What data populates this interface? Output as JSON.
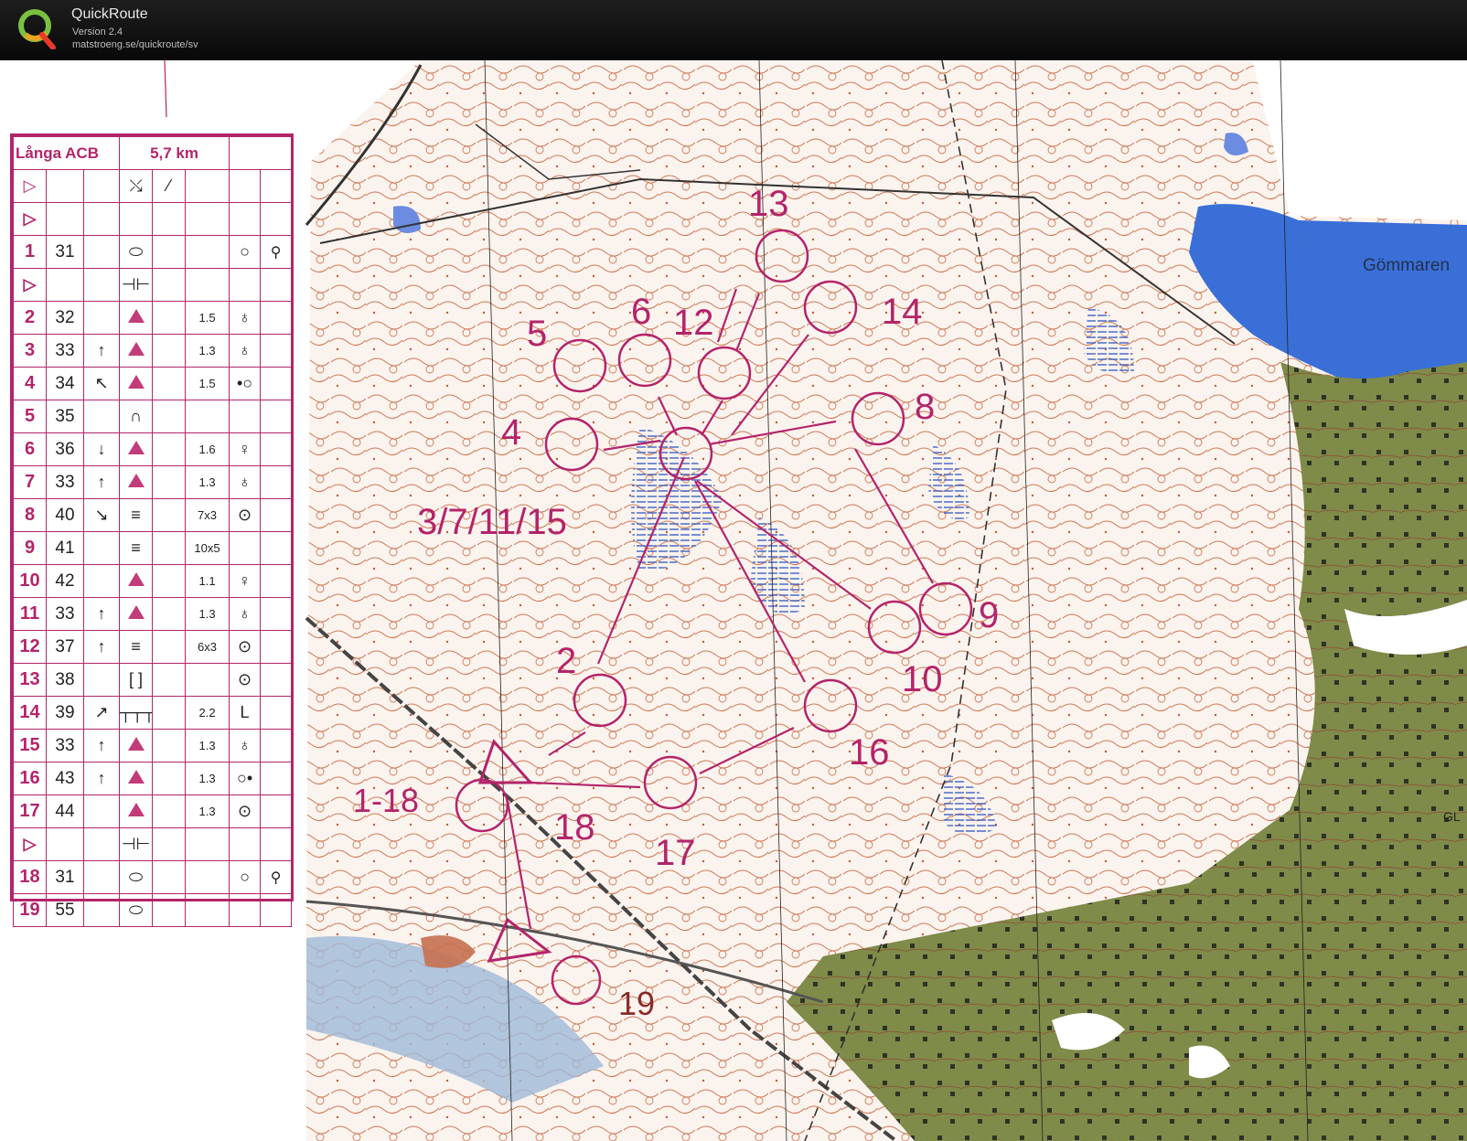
{
  "app": {
    "title": "QuickRoute",
    "version": "Version 2.4",
    "url": "matstroeng.se/quickroute/sv"
  },
  "course": {
    "name": "Långa ACB",
    "length": "5,7 km"
  },
  "rows": [
    {
      "num": "",
      "code": "",
      "dir": "",
      "feature": "",
      "dim": "",
      "appearance": "",
      "extra": "",
      "kind": "start"
    },
    {
      "num": "1",
      "code": "31",
      "dir": "",
      "feature": "",
      "dim": "",
      "appearance": "",
      "extra": "",
      "kind": "control"
    },
    {
      "num": "",
      "code": "",
      "dir": "",
      "feature": "",
      "dim": "",
      "appearance": "",
      "extra": "",
      "kind": "start"
    },
    {
      "num": "2",
      "code": "32",
      "dir": "",
      "feature": "",
      "dim": "1.5",
      "appearance": "",
      "extra": "",
      "kind": "control"
    },
    {
      "num": "3",
      "code": "33",
      "dir": "↑",
      "feature": "",
      "dim": "1.3",
      "appearance": "",
      "extra": "",
      "kind": "control"
    },
    {
      "num": "4",
      "code": "34",
      "dir": "↖",
      "feature": "",
      "dim": "1.5",
      "appearance": "",
      "extra": "",
      "kind": "control"
    },
    {
      "num": "5",
      "code": "35",
      "dir": "",
      "feature": "",
      "dim": "",
      "appearance": "",
      "extra": "",
      "kind": "control"
    },
    {
      "num": "6",
      "code": "36",
      "dir": "↓",
      "feature": "",
      "dim": "1.6",
      "appearance": "",
      "extra": "",
      "kind": "control"
    },
    {
      "num": "7",
      "code": "33",
      "dir": "↑",
      "feature": "",
      "dim": "1.3",
      "appearance": "",
      "extra": "",
      "kind": "control"
    },
    {
      "num": "8",
      "code": "40",
      "dir": "↘",
      "feature": "",
      "dim": "7x3",
      "appearance": "",
      "extra": "",
      "kind": "control"
    },
    {
      "num": "9",
      "code": "41",
      "dir": "",
      "feature": "",
      "dim": "10x5",
      "appearance": "",
      "extra": "",
      "kind": "control"
    },
    {
      "num": "10",
      "code": "42",
      "dir": "",
      "feature": "",
      "dim": "1.1",
      "appearance": "",
      "extra": "",
      "kind": "control"
    },
    {
      "num": "11",
      "code": "33",
      "dir": "↑",
      "feature": "",
      "dim": "1.3",
      "appearance": "",
      "extra": "",
      "kind": "control"
    },
    {
      "num": "12",
      "code": "37",
      "dir": "↑",
      "feature": "",
      "dim": "6x3",
      "appearance": "",
      "extra": "",
      "kind": "control"
    },
    {
      "num": "13",
      "code": "38",
      "dir": "",
      "feature": "",
      "dim": "",
      "appearance": "",
      "extra": "",
      "kind": "control"
    },
    {
      "num": "14",
      "code": "39",
      "dir": "↗",
      "feature": "",
      "dim": "2.2",
      "appearance": "",
      "extra": "",
      "kind": "control"
    },
    {
      "num": "15",
      "code": "33",
      "dir": "↑",
      "feature": "",
      "dim": "1.3",
      "appearance": "",
      "extra": "",
      "kind": "control"
    },
    {
      "num": "16",
      "code": "43",
      "dir": "↑",
      "feature": "",
      "dim": "1.3",
      "appearance": "",
      "extra": "",
      "kind": "control"
    },
    {
      "num": "17",
      "code": "44",
      "dir": "",
      "feature": "",
      "dim": "1.3",
      "appearance": "",
      "extra": "",
      "kind": "control"
    },
    {
      "num": "",
      "code": "",
      "dir": "",
      "feature": "",
      "dim": "",
      "appearance": "",
      "extra": "",
      "kind": "start"
    },
    {
      "num": "18",
      "code": "31",
      "dir": "",
      "feature": "",
      "dim": "",
      "appearance": "",
      "extra": "",
      "kind": "control"
    },
    {
      "num": "19",
      "code": "55",
      "dir": "",
      "feature": "",
      "dim": "",
      "appearance": "",
      "extra": "",
      "kind": "control"
    }
  ],
  "map_labels": {
    "lake": "Gömmaren",
    "c13": "13",
    "c6": "6",
    "c12": "12",
    "c14": "14",
    "c5": "5",
    "c8": "8",
    "c4": "4",
    "c3": "3/7/11/15",
    "c2": "2",
    "c9": "9",
    "c10": "10",
    "c16": "16",
    "c17": "17",
    "c18": "18",
    "c1": "1-18",
    "c19": "19",
    "gl": "GL"
  },
  "colors": {
    "course": "#b3246b",
    "contour": "#c8623a",
    "forest_green": "#7d8a45",
    "water": "#3a6fd8"
  }
}
